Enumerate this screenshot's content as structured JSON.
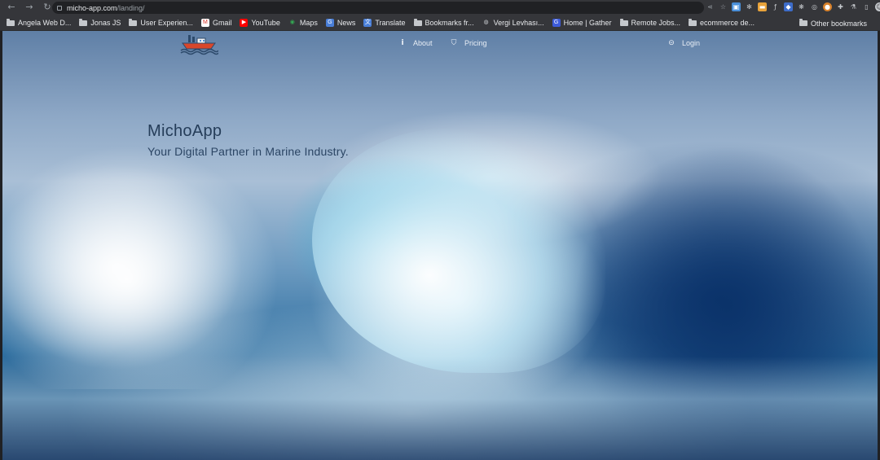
{
  "browser": {
    "url_host": "micho-app.com",
    "url_path": "/landing/",
    "bookmarks": [
      {
        "label": "Angela Web D...",
        "type": "folder"
      },
      {
        "label": "Jonas JS",
        "type": "folder"
      },
      {
        "label": "User Experien...",
        "type": "folder"
      },
      {
        "label": "Gmail",
        "type": "gmail"
      },
      {
        "label": "YouTube",
        "type": "youtube"
      },
      {
        "label": "Maps",
        "type": "maps"
      },
      {
        "label": "News",
        "type": "news"
      },
      {
        "label": "Translate",
        "type": "translate"
      },
      {
        "label": "Bookmarks fr...",
        "type": "folder"
      },
      {
        "label": "Vergi Levhası...",
        "type": "globe"
      },
      {
        "label": "Home | Gather",
        "type": "gather"
      },
      {
        "label": "Remote Jobs...",
        "type": "folder"
      },
      {
        "label": "ecommerce de...",
        "type": "folder"
      }
    ],
    "other_bookmarks": "Other bookmarks"
  },
  "site": {
    "nav": {
      "about": "About",
      "pricing": "Pricing",
      "login": "Login"
    },
    "hero": {
      "title": "MichoApp",
      "subtitle": "Your Digital Partner in Marine Industry."
    }
  },
  "colors": {
    "hero_text": "#253d59",
    "nav_text": "#e8eef5",
    "chrome_bg": "#35363a"
  }
}
